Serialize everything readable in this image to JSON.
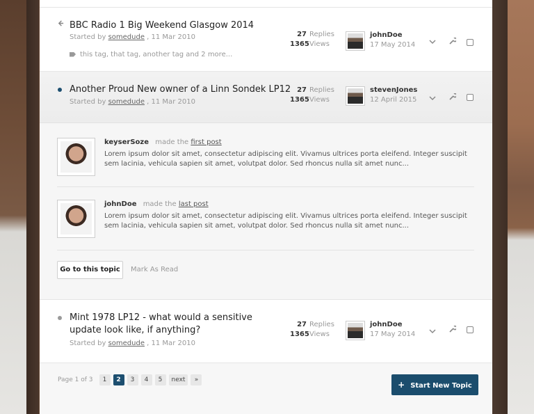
{
  "topics": [
    {
      "title": "BBC Radio 1 Big Weekend Glasgow 2014",
      "started_by_label": "Started by",
      "author": "somedude",
      "date": ", 11 Mar 2010",
      "tags": "this tag, that tag, another tag and 2 more...",
      "replies_count": "27",
      "replies_label": "Replies",
      "views_count": "1365",
      "views_label": "Views",
      "last_user": "johnDoe",
      "last_date": "17 May 2014"
    },
    {
      "title": "Another Proud New owner of a Linn Sondek LP12",
      "started_by_label": "Started by",
      "author": "somedude",
      "date": ", 11 Mar 2010",
      "replies_count": "27",
      "replies_label": "Replies",
      "views_count": "1365",
      "views_label": "Views",
      "last_user": "stevenJones",
      "last_date": "12 April 2015"
    },
    {
      "title": "Mint 1978 LP12 - what would a sensitive update look like, if anything?",
      "started_by_label": "Started by",
      "author": "somedude",
      "date": ", 11 Mar 2010",
      "replies_count": "27",
      "replies_label": "Replies",
      "views_count": "1365",
      "views_label": "Views",
      "last_user": "johnDoe",
      "last_date": "17 May 2014"
    }
  ],
  "preview": {
    "posts": [
      {
        "user": "keyserSoze",
        "made_the": "made the",
        "post_link": "first post",
        "body": "Lorem ipsum dolor sit amet, consectetur adipiscing elit. Vivamus ultrices porta eleifend. Integer suscipit sem lacinia, vehicula sapien sit amet, volutpat dolor. Sed rhoncus nulla sit amet nunc..."
      },
      {
        "user": "johnDoe",
        "made_the": "made the",
        "post_link": "last post",
        "body": "Lorem ipsum dolor sit amet, consectetur adipiscing elit. Vivamus ultrices porta eleifend. Integer suscipit sem lacinia, vehicula sapien sit amet, volutpat dolor. Sed rhoncus nulla sit amet nunc..."
      }
    ],
    "go_to_topic": "Go to this topic",
    "mark_as_read": "Mark As Read"
  },
  "pagination": {
    "label": "Page 1 of 3",
    "pages": [
      "1",
      "2",
      "3",
      "4",
      "5"
    ],
    "active_page": "2",
    "next": "next",
    "last": "»"
  },
  "start_topic": {
    "plus": "+",
    "label": "Start New Topic"
  },
  "icons": {
    "back": "left-arrow-icon",
    "tag": "tag-icon",
    "chevron": "chevron-down-icon",
    "wrench": "wrench-icon"
  },
  "colors": {
    "accent": "#1b4d6d",
    "unread_dot": "#1d4f70"
  }
}
